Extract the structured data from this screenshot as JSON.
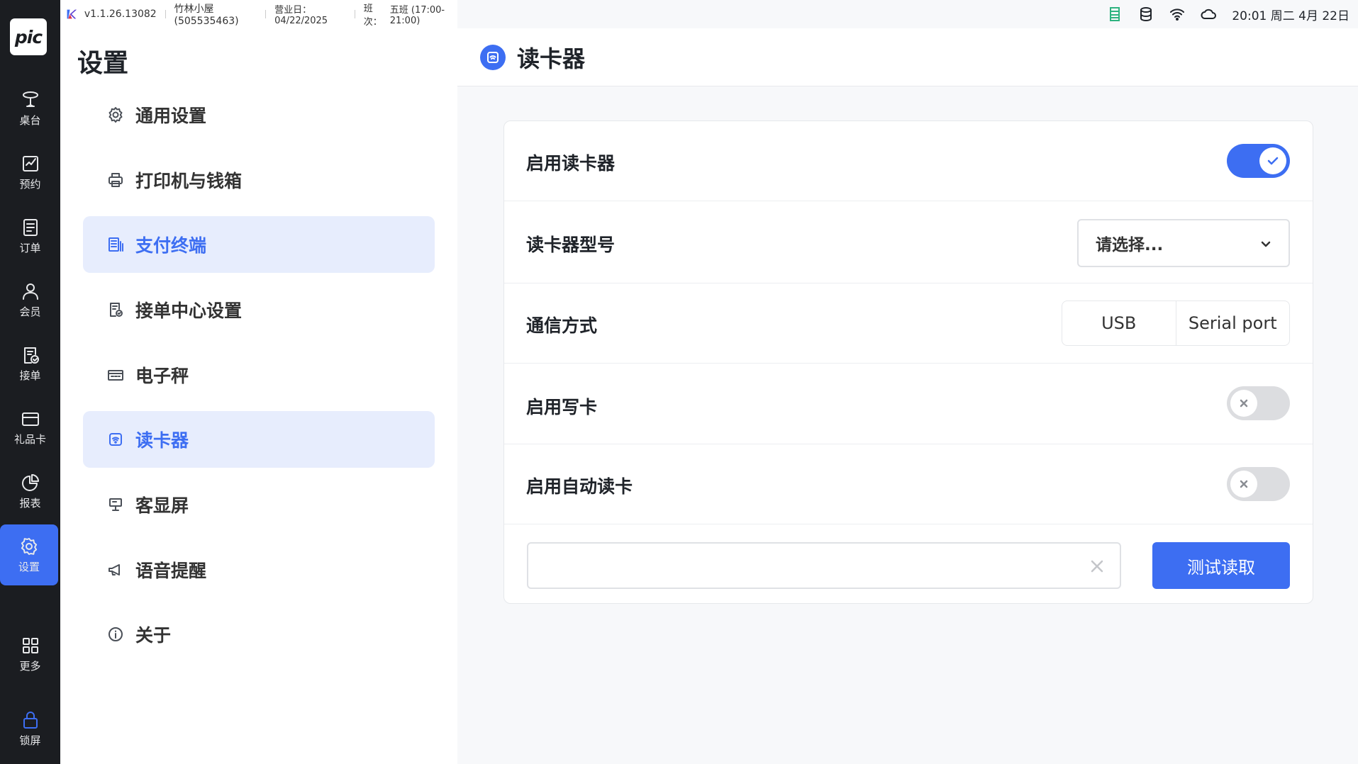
{
  "statusbar": {
    "version": "v1.1.26.13082",
    "store": "竹林小屋(505535463)",
    "business_day": "营业日：04/22/2025",
    "shift": "班次：",
    "shift_value": "五班 (17:00-21:00)",
    "clock": "20:01 周二 4月 22日"
  },
  "logo_text": "pic",
  "leftnav": {
    "items": [
      {
        "label": "桌台",
        "icon": "table-icon"
      },
      {
        "label": "预约",
        "icon": "reservation-icon"
      },
      {
        "label": "订单",
        "icon": "order-icon"
      },
      {
        "label": "会员",
        "icon": "member-icon"
      },
      {
        "label": "接单",
        "icon": "accept-order-icon"
      },
      {
        "label": "礼品卡",
        "icon": "gift-card-icon"
      },
      {
        "label": "报表",
        "icon": "report-icon"
      },
      {
        "label": "设置",
        "icon": "settings-icon",
        "active": true
      },
      {
        "label": "更多",
        "icon": "more-icon"
      },
      {
        "label": "锁屏",
        "icon": "lock-icon"
      }
    ]
  },
  "settings": {
    "title": "设置",
    "items": [
      {
        "label": "通用设置",
        "icon": "gear-icon"
      },
      {
        "label": "打印机与钱箱",
        "icon": "printer-icon"
      },
      {
        "label": "支付终端",
        "icon": "payment-terminal-icon",
        "active": true
      },
      {
        "label": "接单中心设置",
        "icon": "order-center-icon"
      },
      {
        "label": "电子秤",
        "icon": "scale-icon"
      },
      {
        "label": "读卡器",
        "icon": "card-reader-icon",
        "active": true
      },
      {
        "label": "客显屏",
        "icon": "customer-display-icon"
      },
      {
        "label": "语音提醒",
        "icon": "megaphone-icon"
      },
      {
        "label": "关于",
        "icon": "info-icon"
      }
    ]
  },
  "main": {
    "title": "读卡器",
    "enable_reader": {
      "label": "启用读卡器",
      "enabled": true
    },
    "reader_model": {
      "label": "读卡器型号",
      "placeholder": "请选择..."
    },
    "comm_method": {
      "label": "通信方式",
      "options": [
        "USB",
        "Serial port"
      ]
    },
    "enable_write": {
      "label": "启用写卡",
      "enabled": false
    },
    "enable_auto_read": {
      "label": "启用自动读卡",
      "enabled": false
    },
    "test_input_value": "",
    "test_button": "测试读取"
  },
  "colors": {
    "accent": "#3d6ef2",
    "nav_bg": "#1b1d21",
    "active_bg": "#e7edfd"
  }
}
